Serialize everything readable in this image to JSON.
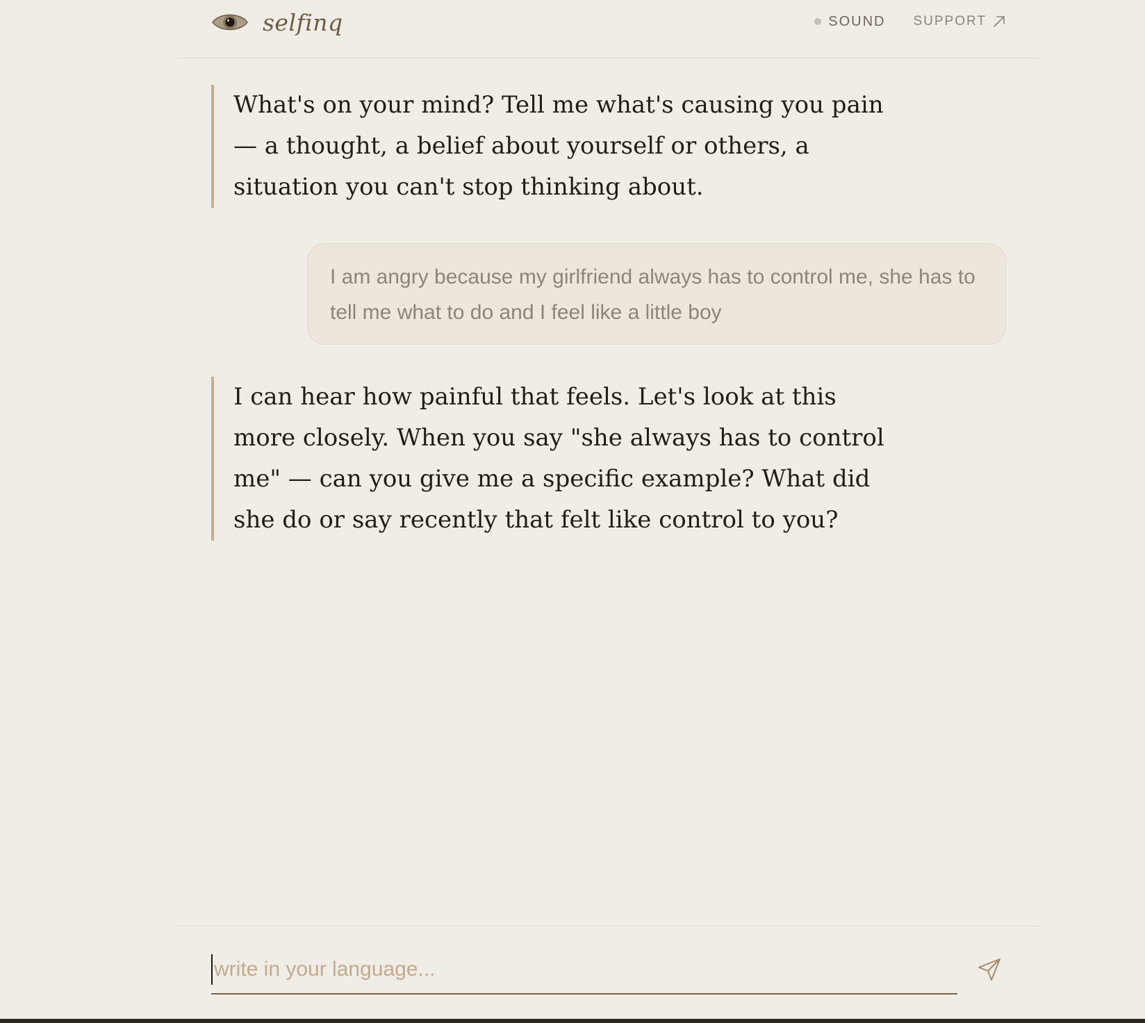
{
  "app": {
    "name": "selfinq",
    "accent_color": "#c8ad8e",
    "brand_color": "#6e5b43"
  },
  "header": {
    "logo_icon": "eye-icon",
    "brand": "selfinq",
    "sound_label": "SOUND",
    "sound_status_icon": "status-dot",
    "support_label": "SUPPORT",
    "support_icon": "external-arrow-icon"
  },
  "conversation": {
    "messages": [
      {
        "role": "assistant",
        "text": "What's on your mind? Tell me what's causing you pain — a thought, a belief about yourself or others, a situation you can't stop thinking about."
      },
      {
        "role": "user",
        "text": "I am angry because my girlfriend always has to control me, she has to tell me what to do and I feel like a little boy"
      },
      {
        "role": "assistant",
        "text": "I can hear how painful that feels. Let's look at this more closely. When you say \"she always has to control me\" — can you give me a specific example? What did she do or say recently that felt like control to you?"
      }
    ]
  },
  "composer": {
    "placeholder": "write in your language...",
    "value": "",
    "send_icon": "send-icon"
  }
}
